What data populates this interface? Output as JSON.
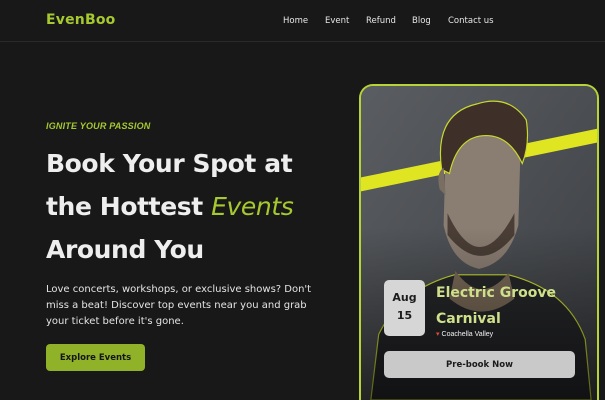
{
  "brand": {
    "logo": "EvenBoo",
    "accent_color": "#a6c92f"
  },
  "nav": {
    "items": [
      "Home",
      "Event",
      "Refund",
      "Blog",
      "Contact us"
    ]
  },
  "hero": {
    "eyebrow": "IGNITE YOUR PASSION",
    "headline_line1": "Book Your Spot at",
    "headline_line2_prefix": "the Hottest ",
    "headline_line2_highlight": "Events",
    "headline_line3": "Around You",
    "description": "Love concerts, workshops, or exclusive shows? Don't miss a beat! Discover top events near you and grab your ticket before it's gone.",
    "cta_label": "Explore Events"
  },
  "event_card": {
    "month": "Aug",
    "day": "15",
    "title_line1": "Electric Groove",
    "title_line2": "Carnival",
    "location_icon": "map-pin-icon",
    "location": "Coachella Valley",
    "cta_label": "Pre-book Now"
  }
}
